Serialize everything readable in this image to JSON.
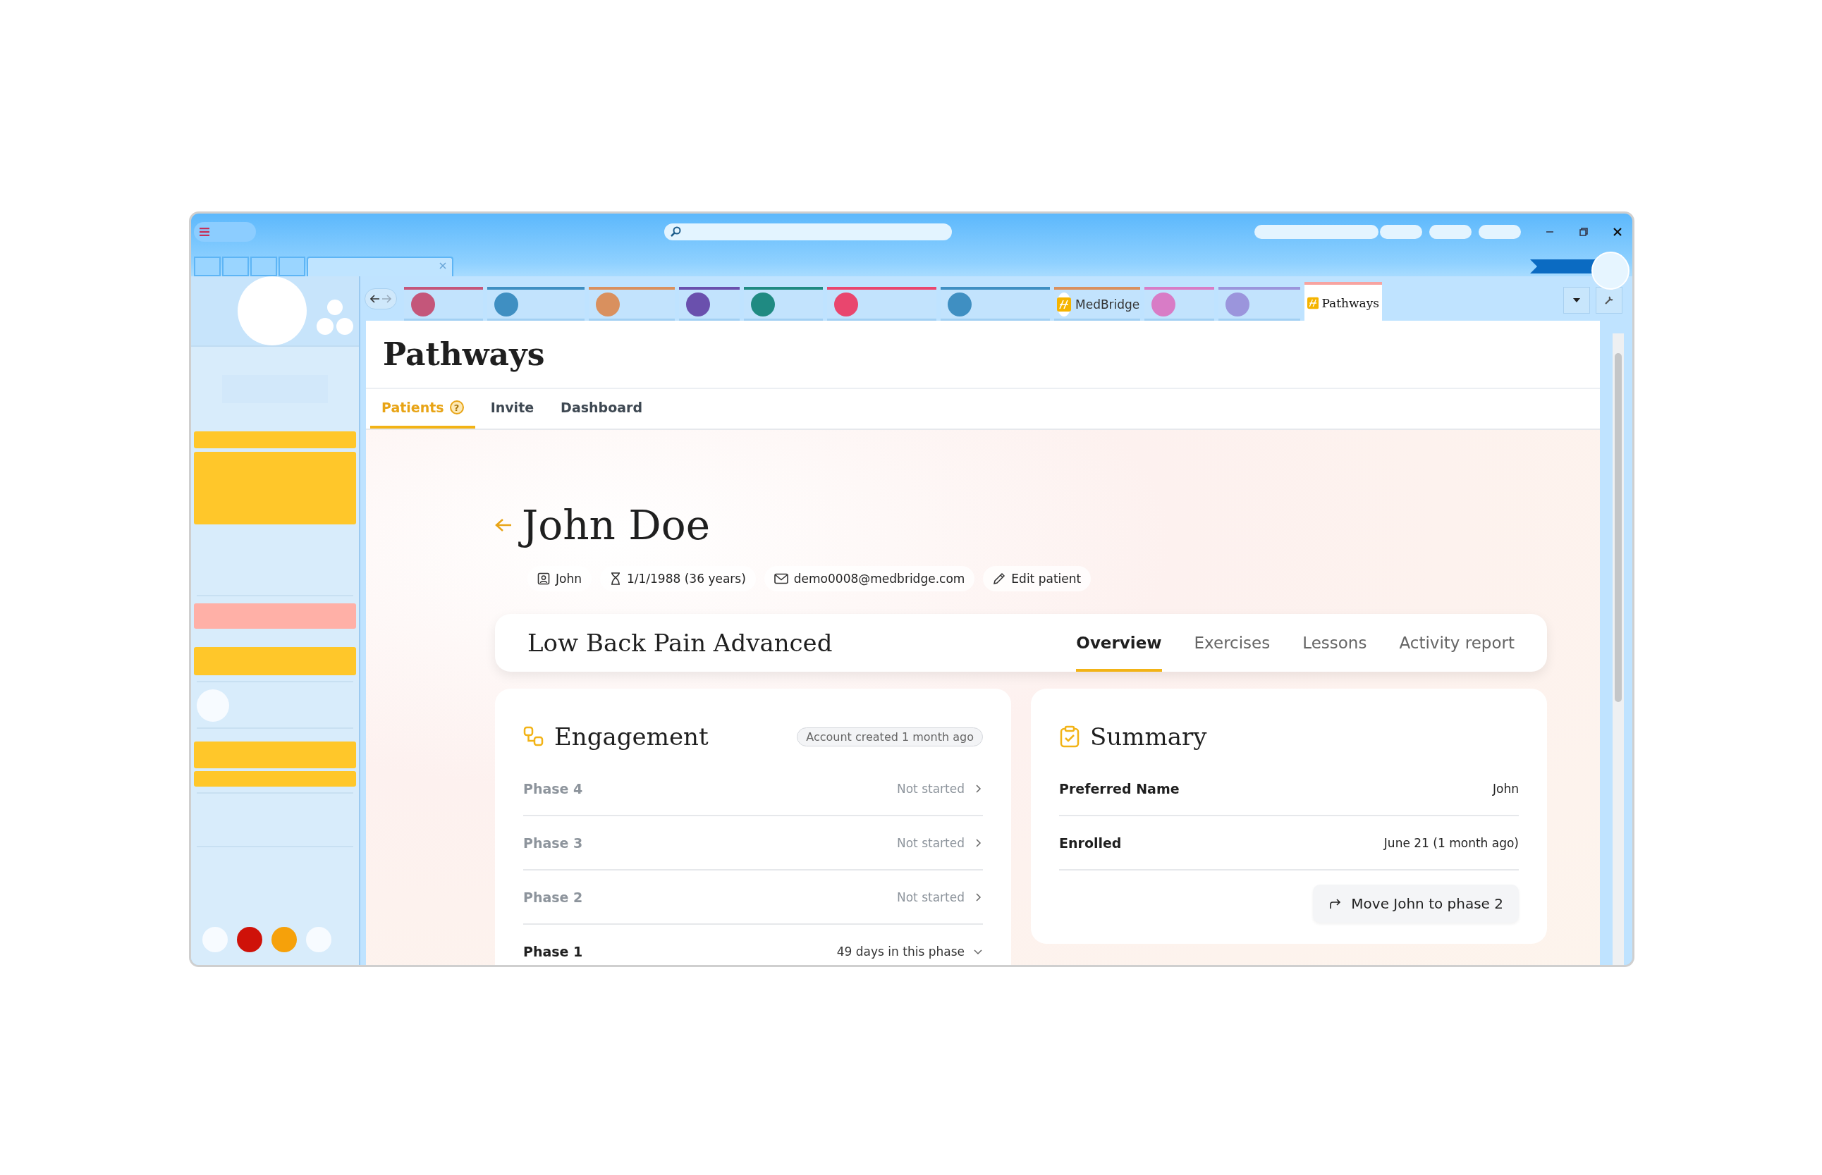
{
  "browser_tabs": [
    {
      "color": "#c4567a",
      "selected": false
    },
    {
      "color": "#3f8fc2",
      "selected": false
    },
    {
      "color": "#d9905e",
      "selected": false
    },
    {
      "color": "#6a50ad",
      "selected": false
    },
    {
      "color": "#1f8a82",
      "selected": false
    },
    {
      "color": "#e9466e",
      "selected": false
    },
    {
      "color": "#3f8fc2",
      "selected": false
    },
    {
      "label": "MedBridge",
      "color": "#d9905e",
      "selected": false
    },
    {
      "color": "#d87cc6",
      "selected": false
    },
    {
      "color": "#9b95dc",
      "selected": false
    },
    {
      "label": "Pathways",
      "color": "#f7a3a0",
      "selected": true
    }
  ],
  "app": {
    "title": "Pathways",
    "tabs": [
      {
        "label": "Patients",
        "help": "?",
        "selected": true
      },
      {
        "label": "Invite",
        "selected": false
      },
      {
        "label": "Dashboard",
        "selected": false
      }
    ]
  },
  "patient": {
    "name": "John Doe",
    "details": [
      {
        "kind": "person",
        "text": "John"
      },
      {
        "kind": "birthdate",
        "text": "1/1/1988 (36 years)"
      },
      {
        "kind": "email",
        "text": "demo0008@medbridge.com"
      },
      {
        "kind": "edit",
        "text": "Edit patient"
      }
    ]
  },
  "program": {
    "title": "Low Back Pain Advanced",
    "tabs": [
      {
        "label": "Overview",
        "selected": true
      },
      {
        "label": "Exercises",
        "selected": false
      },
      {
        "label": "Lessons",
        "selected": false
      },
      {
        "label": "Activity report",
        "selected": false
      }
    ]
  },
  "engagement": {
    "title": "Engagement",
    "badge": "Account created 1 month ago",
    "phases": [
      {
        "name": "Phase 4",
        "status": "Not started",
        "started": false,
        "expanded": false
      },
      {
        "name": "Phase 3",
        "status": "Not started",
        "started": false,
        "expanded": false
      },
      {
        "name": "Phase 2",
        "status": "Not started",
        "started": false,
        "expanded": false
      },
      {
        "name": "Phase 1",
        "status": "49 days in this phase",
        "started": true,
        "expanded": true
      }
    ]
  },
  "summary": {
    "title": "Summary",
    "rows": [
      {
        "label": "Preferred Name",
        "value": "John"
      },
      {
        "label": "Enrolled",
        "value": "June 21 (1 month ago)"
      }
    ],
    "action": "Move John to phase 2"
  }
}
